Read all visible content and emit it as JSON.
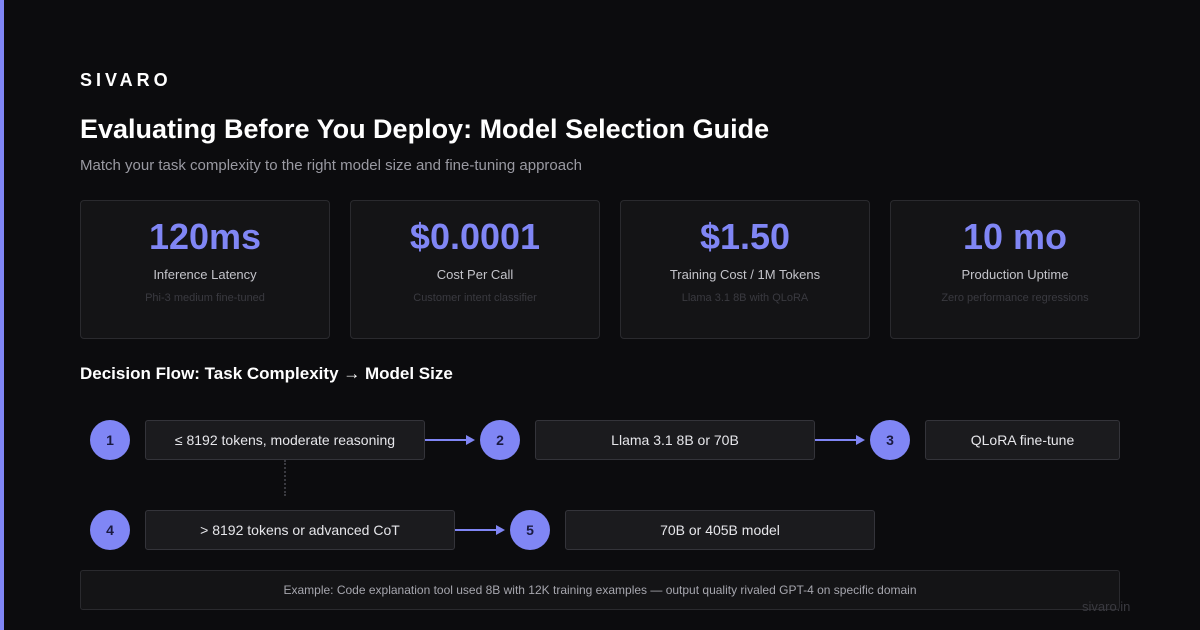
{
  "brand": "SIVARO",
  "title": "Evaluating Before You Deploy: Model Selection Guide",
  "subtitle": "Match your task complexity to the right model size and fine-tuning approach",
  "stats": [
    {
      "value": "120ms",
      "label": "Inference Latency",
      "sub": "Phi-3 medium fine-tuned"
    },
    {
      "value": "$0.0001",
      "label": "Cost Per Call",
      "sub": "Customer intent classifier"
    },
    {
      "value": "$1.50",
      "label": "Training Cost / 1M Tokens",
      "sub": "Llama 3.1 8B with QLoRA"
    },
    {
      "value": "10 mo",
      "label": "Production Uptime",
      "sub": "Zero performance regressions"
    }
  ],
  "flow": {
    "title": "Decision Flow: Task Complexity → Model Size",
    "nodes": [
      "1",
      "2",
      "3",
      "4",
      "5"
    ],
    "steps": [
      "≤ 8192 tokens, moderate reasoning",
      "Llama 3.1 8B or 70B",
      "QLoRA fine-tune",
      "> 8192 tokens or advanced CoT",
      "70B or 405B model"
    ]
  },
  "example": "Example: Code explanation tool used 8B with 12K training examples — output quality rivaled GPT-4 on specific domain",
  "domain": "sivaro.in",
  "colors": {
    "accent": "#8086f5",
    "background": "#0c0c0e",
    "card": "#141416"
  }
}
